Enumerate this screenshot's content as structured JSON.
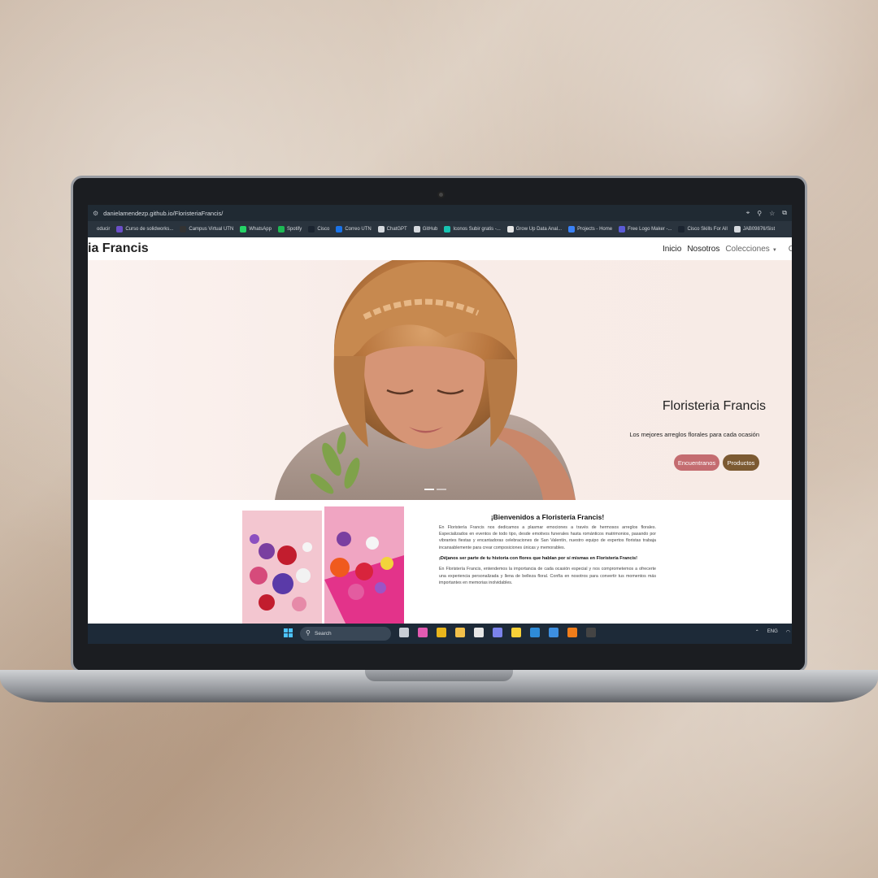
{
  "browser": {
    "url": "danielamendezp.github.io/FloristeriaFrancis/",
    "bookmarks": [
      {
        "label": "oducir",
        "color": "#2a343e"
      },
      {
        "label": "Curso de solidworks...",
        "color": "#6b4fc9"
      },
      {
        "label": "Campus Virtual UTN",
        "color": "#333"
      },
      {
        "label": "WhatsApp",
        "color": "#25d366"
      },
      {
        "label": "Spotify",
        "color": "#1db954"
      },
      {
        "label": "Cisco",
        "color": "#1b2430"
      },
      {
        "label": "Correo UTN",
        "color": "#1a73e8"
      },
      {
        "label": "ChatGPT",
        "color": "#d5d9de"
      },
      {
        "label": "GitHub",
        "color": "#d5d9de"
      },
      {
        "label": "Iconos Subir gratis -...",
        "color": "#17c3b2"
      },
      {
        "label": "Grow Up Data Anal...",
        "color": "#e6e6e6"
      },
      {
        "label": "Projects - Home",
        "color": "#3b82f6"
      },
      {
        "label": "Free Logo Maker -...",
        "color": "#5b5bd6"
      },
      {
        "label": "Cisco Skills For All",
        "color": "#1b2430"
      },
      {
        "label": "JAB09876/Sist",
        "color": "#d5d9de"
      }
    ]
  },
  "navbar": {
    "brand": "ia Francis",
    "links": [
      "Inicio",
      "Nosotros",
      "Colecciones",
      "C"
    ]
  },
  "hero": {
    "title": "Floristeria Francis",
    "subtitle": "Los mejores arreglos florales para cada ocasión",
    "buttons": [
      {
        "label": "Encuentranos",
        "color": "#c46c70"
      },
      {
        "label": "Productos",
        "color": "#7c5a32"
      }
    ]
  },
  "welcome": {
    "heading": "¡Bienvenidos a Floristería Francis!",
    "p1": "En Floristería Francis nos dedicamos a plasmar emociones a través de hermosos arreglos florales. Especializados en eventos de todo tipo, desde emotivos funerales hasta románticos matrimonios, pasando por vibrantes fiestas y encantadoras celebraciones de San Valentín, nuestro equipo de expertos floristas trabaja incansablemente para crear composiciones únicas y memorables.",
    "p2": "¡Déjanos ser parte de tu historia con flores que hablan por sí mismas en Floristería Francis!",
    "p3": "En Floristería Francis, entendemos la importancia de cada ocasión especial y nos comprometemos a ofrecerte una experiencia personalizada y llena de belleza floral. Confía en nosotros para convertir tus momentos más importantes en memorias inolvidables."
  },
  "taskbar": {
    "search_placeholder": "Search",
    "lang": "ENG",
    "apps": [
      {
        "name": "task-view-icon",
        "color": "#c8ced6"
      },
      {
        "name": "copilot-icon",
        "color": "#e25ab2"
      },
      {
        "name": "chrome-icon",
        "color": "#e8b51c"
      },
      {
        "name": "file-explorer-icon",
        "color": "#f2c04a"
      },
      {
        "name": "snipping-icon",
        "color": "#e6e6e6"
      },
      {
        "name": "teams-icon",
        "color": "#7b83eb"
      },
      {
        "name": "sticky-notes-icon",
        "color": "#f7d038"
      },
      {
        "name": "vscode-icon",
        "color": "#2e8bd8"
      },
      {
        "name": "tool-icon",
        "color": "#3d8fe0"
      },
      {
        "name": "xampp-icon",
        "color": "#f07d1a"
      },
      {
        "name": "terminal-icon",
        "color": "#444"
      }
    ]
  }
}
